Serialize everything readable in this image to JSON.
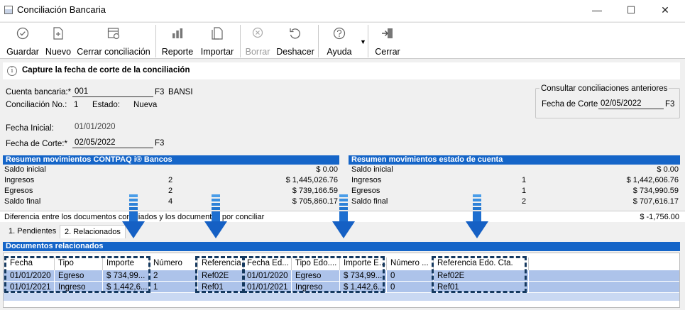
{
  "window": {
    "title": "Conciliación Bancaria",
    "controls": {
      "minimize": "—",
      "maximize": "☐",
      "close": "✕"
    }
  },
  "toolbar": {
    "guardar": "Guardar",
    "nuevo": "Nuevo",
    "cerrar_conciliacion": "Cerrar conciliación",
    "reporte": "Reporte",
    "importar": "Importar",
    "borrar": "Borrar",
    "deshacer": "Deshacer",
    "ayuda": "Ayuda",
    "cerrar": "Cerrar"
  },
  "info": {
    "message": "Capture la fecha de corte de la conciliación"
  },
  "form": {
    "cuenta_label": "Cuenta bancaria:*",
    "cuenta_value": "001",
    "cuenta_f3": "F3",
    "cuenta_name": "BANSI",
    "conciliacion_label": "Conciliación No.:",
    "conciliacion_value": "1",
    "estado_label": "Estado:",
    "estado_value": "Nueva",
    "fecha_inicial_label": "Fecha Inicial:",
    "fecha_inicial_value": "01/01/2020",
    "fecha_corte_label": "Fecha de Corte:*",
    "fecha_corte_value": "02/05/2022",
    "fecha_corte_f3": "F3"
  },
  "consultar": {
    "title": "Consultar conciliaciones anteriores",
    "fecha_label": "Fecha de Corte:",
    "fecha_value": "02/05/2022",
    "f3": "F3"
  },
  "resumen_contpaq": {
    "title": "Resumen movimientos CONTPAQ i® Bancos",
    "rows": [
      {
        "label": "Saldo inicial",
        "count": "",
        "amount": "$ 0.00"
      },
      {
        "label": "Ingresos",
        "count": "2",
        "amount": "$ 1,445,026.76"
      },
      {
        "label": "Egresos",
        "count": "2",
        "amount": "$ 739,166.59"
      },
      {
        "label": "Saldo final",
        "count": "4",
        "amount": "$ 705,860.17"
      }
    ]
  },
  "resumen_estado": {
    "title": "Resumen movimientos estado de cuenta",
    "rows": [
      {
        "label": "Saldo inicial",
        "count": "",
        "amount": "$ 0.00"
      },
      {
        "label": "Ingresos",
        "count": "1",
        "amount": "$ 1,442,606.76"
      },
      {
        "label": "Egresos",
        "count": "1",
        "amount": "$ 734,990.59"
      },
      {
        "label": "Saldo final",
        "count": "2",
        "amount": "$ 707,616.17"
      }
    ]
  },
  "diferencia": {
    "label": "Diferencia entre los documentos conciliados y los documentos por conciliar",
    "amount": "$ -1,756.00"
  },
  "tabs": [
    {
      "label": "1. Pendientes"
    },
    {
      "label": "2. Relacionados"
    }
  ],
  "grid": {
    "title": "Documentos relacionados",
    "columns": [
      "Fecha",
      "Tipo",
      "Importe",
      "Número",
      "Referencia",
      "Fecha Ed...",
      "Tipo Edo....",
      "Importe E...",
      "Número ...",
      "Referencia Edo. Cta."
    ],
    "rows": [
      [
        "01/01/2020",
        "Egreso",
        "$ 734,99...",
        "2",
        "Ref02E",
        "01/01/2020",
        "Egreso",
        "$ 734,99...",
        "0",
        "Ref02E"
      ],
      [
        "01/01/2021",
        "Ingreso",
        "$ 1,442,6...",
        "1",
        "Ref01",
        "01/01/2021",
        "Ingreso",
        "$ 1,442,6...",
        "0",
        "Ref01"
      ]
    ]
  },
  "colors": {
    "accent": "#1565c8",
    "row_highlight": "#adc3ea",
    "dashed_outline": "#15395f",
    "arrow": "#1e6fd0"
  },
  "icons": [
    "app-icon",
    "save-icon",
    "new-icon",
    "close-reconciliation-icon",
    "report-icon",
    "import-icon",
    "delete-icon",
    "undo-icon",
    "help-icon",
    "exit-icon",
    "info-icon",
    "down-arrow-icon"
  ]
}
